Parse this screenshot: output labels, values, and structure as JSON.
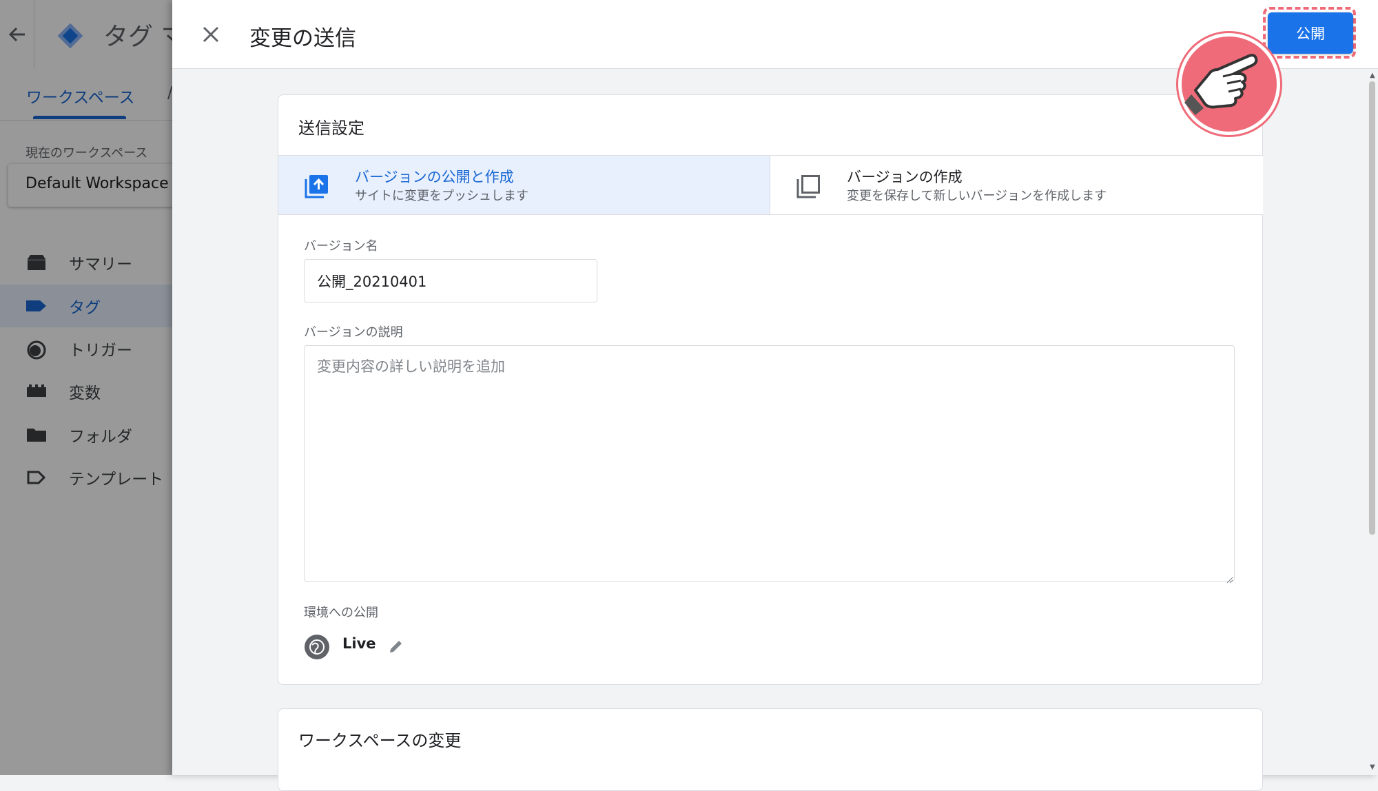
{
  "background": {
    "app_title": "タグ マ",
    "tabs": [
      "ワークスペース",
      "/"
    ],
    "workspace_label": "現在のワークスペース",
    "workspace_name": "Default Workspace",
    "nav": [
      {
        "label": "サマリー",
        "icon": "briefcase-icon",
        "active": false
      },
      {
        "label": "タグ",
        "icon": "tag-icon",
        "active": true
      },
      {
        "label": "トリガー",
        "icon": "trigger-icon",
        "active": false
      },
      {
        "label": "変数",
        "icon": "variables-icon",
        "active": false
      },
      {
        "label": "フォルダ",
        "icon": "folder-icon",
        "active": false
      },
      {
        "label": "テンプレート",
        "icon": "template-icon",
        "active": false
      }
    ]
  },
  "panel": {
    "title": "変更の送信",
    "publish_label": "公開"
  },
  "submit_settings": {
    "title": "送信設定",
    "options": [
      {
        "title": "バージョンの公開と作成",
        "subtitle": "サイトに変更をプッシュします",
        "selected": true
      },
      {
        "title": "バージョンの作成",
        "subtitle": "変更を保存して新しいバージョンを作成します",
        "selected": false
      }
    ],
    "version_name_label": "バージョン名",
    "version_name_value": "公開_20210401",
    "version_desc_label": "バージョンの説明",
    "version_desc_placeholder": "変更内容の詳しい説明を追加",
    "env_label": "環境への公開",
    "env_name": "Live"
  },
  "workspace_changes": {
    "title": "ワークスペースの変更"
  },
  "colors": {
    "accent": "#1a73e8",
    "highlight": "#ef6b79",
    "selected_bg": "#e8f0fe"
  }
}
